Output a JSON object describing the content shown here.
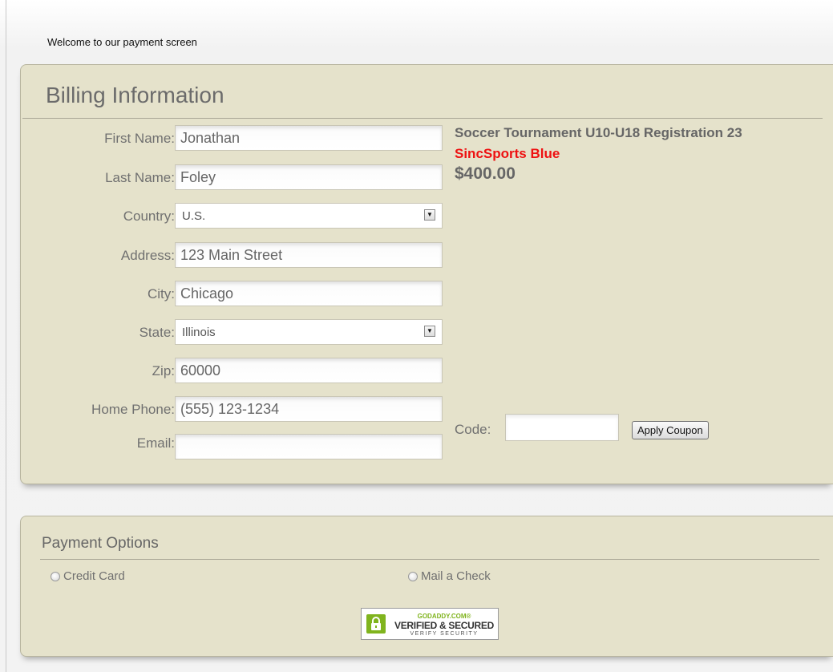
{
  "welcome_text": "Welcome to our payment screen",
  "billing": {
    "title": "Billing Information",
    "fields": {
      "first_name": {
        "label": "First Name:",
        "value": "Jonathan"
      },
      "last_name": {
        "label": "Last Name:",
        "value": "Foley"
      },
      "country": {
        "label": "Country:",
        "value": "U.S."
      },
      "address": {
        "label": "Address:",
        "value": "123 Main Street"
      },
      "city": {
        "label": "City:",
        "value": "Chicago"
      },
      "state": {
        "label": "State:",
        "value": "Illinois"
      },
      "zip": {
        "label": "Zip:",
        "value": "60000"
      },
      "home_phone": {
        "label": "Home Phone:",
        "value": "(555) 123-1234"
      },
      "email": {
        "label": "Email:",
        "value": ""
      }
    },
    "event": {
      "title": "Soccer Tournament U10-U18 Registration 23",
      "team": "SincSports Blue",
      "price": "$400.00"
    },
    "coupon": {
      "label": "Code:",
      "value": "",
      "button_label": "Apply Coupon"
    }
  },
  "payment": {
    "title": "Payment Options",
    "options": {
      "credit_card": "Credit Card",
      "mail_check": "Mail a Check"
    },
    "seal": {
      "top": "GODADDY.COM®",
      "middle": "VERIFIED & SECURED",
      "bottom": "VERIFY SECURITY",
      "icon": "lock-icon"
    }
  },
  "colors": {
    "panel_background": "#e5e2cb",
    "team_name": "#ee1111",
    "seal_green": "#80b41e"
  }
}
